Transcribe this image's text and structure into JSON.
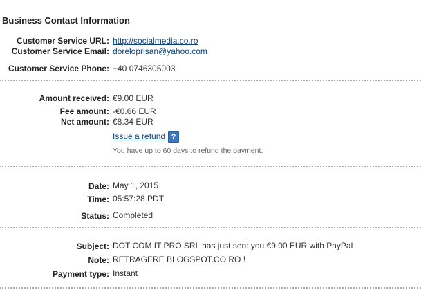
{
  "business_contact": {
    "title": "Business Contact Information",
    "url_label": "Customer Service URL:",
    "url_value": "http://socialmedia.co.ro",
    "email_label": "Customer Service Email:",
    "email_value": "doreloprisan@yahoo.com",
    "phone_label": "Customer Service Phone:",
    "phone_value": "+40 0746305003"
  },
  "amounts": {
    "received_label": "Amount received:",
    "received_value": "€9.00 EUR",
    "fee_label": "Fee amount:",
    "fee_value": "-€0.66 EUR",
    "net_label": "Net amount:",
    "net_value": "€8.34 EUR",
    "refund_link": "Issue a refund",
    "help_icon": "?",
    "refund_note": "You have up to 60 days to refund the payment."
  },
  "details": {
    "date_label": "Date:",
    "date_value": "May 1, 2015",
    "time_label": "Time:",
    "time_value": "05:57:28 PDT",
    "status_label": "Status:",
    "status_value": "Completed"
  },
  "message": {
    "subject_label": "Subject:",
    "subject_value": "DOT COM IT PRO SRL has just sent you €9.00 EUR with PayPal",
    "note_label": "Note:",
    "note_value": "RETRAGERE BLOGSPOT.CO.RO !",
    "payment_type_label": "Payment type:",
    "payment_type_value": "Instant"
  },
  "colors": {
    "link": "#084482",
    "help_icon_bg": "#3a78c2",
    "divider": "#aaaaaa"
  }
}
